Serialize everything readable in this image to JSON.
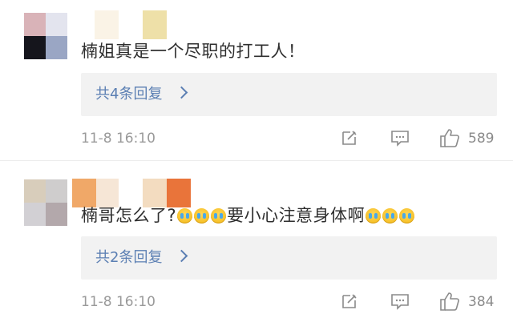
{
  "comments": [
    {
      "text": "楠姐真是一个尽职的打工人！",
      "replies_label": "共4条回复",
      "timestamp": "11-8 16:10",
      "likes": "589"
    },
    {
      "text_before": "楠哥怎么了?",
      "text_middle": "要小心注意身体啊",
      "replies_label": "共2条回复",
      "timestamp": "11-8 16:10",
      "likes": "384"
    }
  ],
  "icons": {
    "edit": "edit-icon",
    "comment": "comment-icon",
    "like": "thumbs-up-icon"
  },
  "colors": {
    "link": "#5b7fb3",
    "reply_box": "#f2f2f2",
    "meta": "#9a9a9a",
    "text": "#2e2e2e"
  }
}
